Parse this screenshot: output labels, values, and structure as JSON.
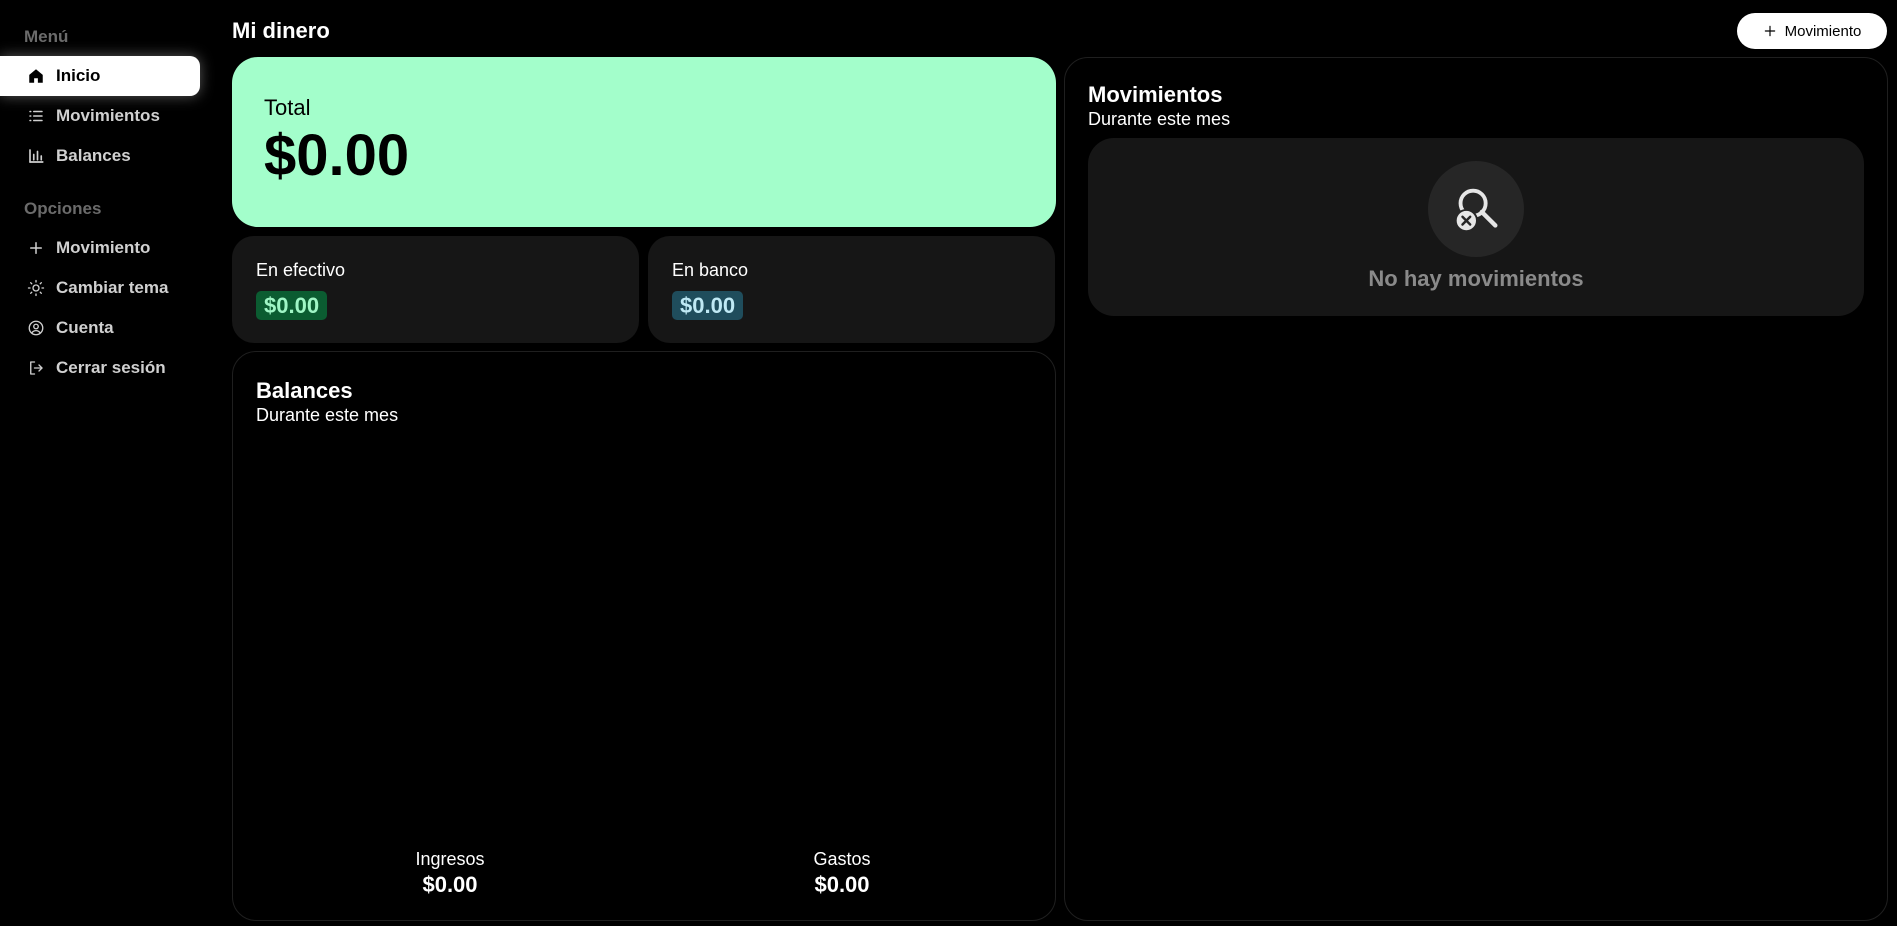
{
  "header": {
    "title": "Mi dinero",
    "add_button_label": "Movimiento"
  },
  "sidebar": {
    "menu_title": "Menú",
    "menu_items": [
      {
        "label": "Inicio",
        "icon": "home-icon",
        "active": true
      },
      {
        "label": "Movimientos",
        "icon": "list-icon",
        "active": false
      },
      {
        "label": "Balances",
        "icon": "bar-chart-icon",
        "active": false
      }
    ],
    "options_title": "Opciones",
    "option_items": [
      {
        "label": "Movimiento",
        "icon": "plus-icon"
      },
      {
        "label": "Cambiar tema",
        "icon": "sun-icon"
      },
      {
        "label": "Cuenta",
        "icon": "user-circle-icon"
      },
      {
        "label": "Cerrar sesión",
        "icon": "logout-icon"
      }
    ]
  },
  "total": {
    "label": "Total",
    "value": "$0.00"
  },
  "cash": {
    "label": "En efectivo",
    "value": "$0.00"
  },
  "bank": {
    "label": "En banco",
    "value": "$0.00"
  },
  "balances": {
    "title": "Balances",
    "subtitle": "Durante este mes",
    "income_label": "Ingresos",
    "income_value": "$0.00",
    "expense_label": "Gastos",
    "expense_value": "$0.00"
  },
  "movements": {
    "title": "Movimientos",
    "subtitle": "Durante este mes",
    "empty_text": "No hay movimientos",
    "empty_icon": "search-off-icon"
  },
  "colors": {
    "background": "#000000",
    "total_card": "#a3fecb",
    "card": "#161616",
    "cash_pill": "#0b5c31",
    "bank_pill": "#1f4d5c"
  }
}
